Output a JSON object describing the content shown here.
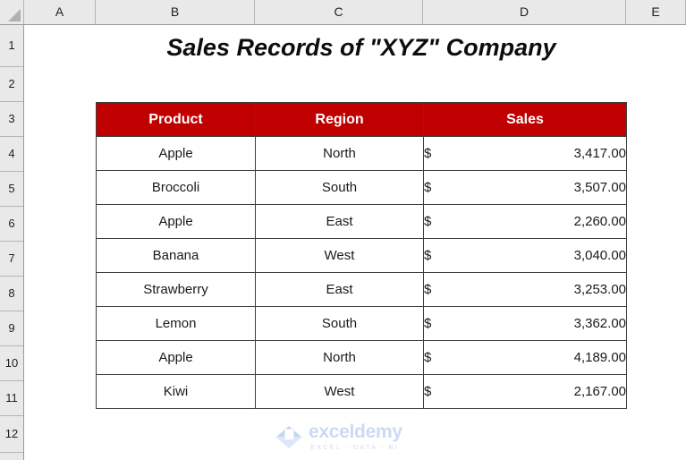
{
  "spreadsheet": {
    "title": "Sales Records of \"XYZ\" Company",
    "select_all_icon": "select-all-triangle-icon",
    "column_headers": [
      "A",
      "B",
      "C",
      "D",
      "E"
    ],
    "row_headers": [
      "1",
      "2",
      "3",
      "4",
      "5",
      "6",
      "7",
      "8",
      "9",
      "10",
      "11",
      "12"
    ]
  },
  "table": {
    "header_background": "#C00000",
    "header_text_color": "#FFFFFF",
    "columns": [
      "Product",
      "Region",
      "Sales"
    ],
    "rows": [
      {
        "product": "Apple",
        "region": "North",
        "currency": "$",
        "amount": "3,417.00"
      },
      {
        "product": "Broccoli",
        "region": "South",
        "currency": "$",
        "amount": "3,507.00"
      },
      {
        "product": "Apple",
        "region": "East",
        "currency": "$",
        "amount": "2,260.00"
      },
      {
        "product": "Banana",
        "region": "West",
        "currency": "$",
        "amount": "3,040.00"
      },
      {
        "product": "Strawberry",
        "region": "East",
        "currency": "$",
        "amount": "3,253.00"
      },
      {
        "product": "Lemon",
        "region": "South",
        "currency": "$",
        "amount": "3,362.00"
      },
      {
        "product": "Apple",
        "region": "North",
        "currency": "$",
        "amount": "4,189.00"
      },
      {
        "product": "Kiwi",
        "region": "West",
        "currency": "$",
        "amount": "2,167.00"
      }
    ]
  },
  "watermark": {
    "name": "exceldemy",
    "tagline": "EXCEL - DATA - BI",
    "logo_icon": "exceldemy-cube-logo-icon",
    "color": "#CCDAF2"
  }
}
